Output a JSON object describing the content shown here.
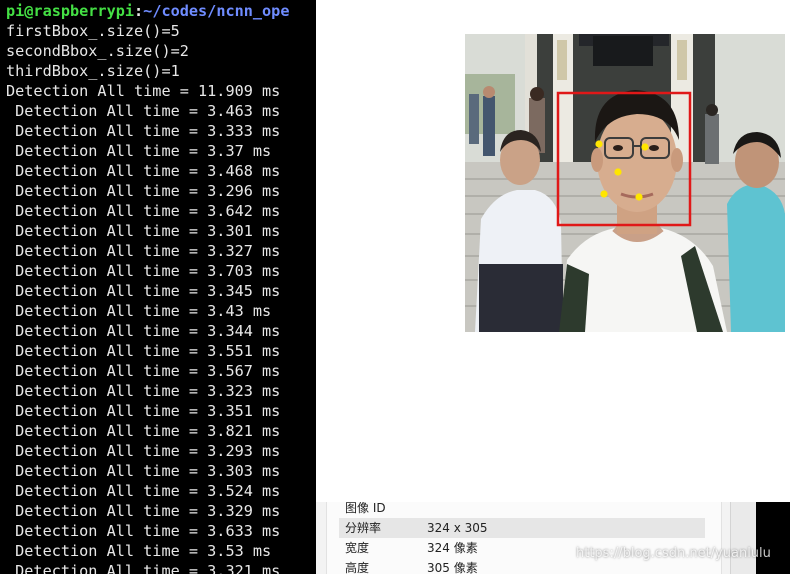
{
  "terminal": {
    "prompt": {
      "user_host": "pi@raspberrypi",
      "separator": ":",
      "path": "~/codes/ncnn_ope"
    },
    "lines": [
      "firstBbox_.size()=5",
      "secondBbox_.size()=2",
      "thirdBbox_.size()=1",
      "Detection All time = 11.909 ms",
      " Detection All time = 3.463 ms",
      " Detection All time = 3.333 ms",
      " Detection All time = 3.37 ms",
      " Detection All time = 3.468 ms",
      " Detection All time = 3.296 ms",
      " Detection All time = 3.642 ms",
      " Detection All time = 3.301 ms",
      " Detection All time = 3.327 ms",
      " Detection All time = 3.703 ms",
      " Detection All time = 3.345 ms",
      " Detection All time = 3.43 ms",
      " Detection All time = 3.344 ms",
      " Detection All time = 3.551 ms",
      " Detection All time = 3.567 ms",
      " Detection All time = 3.323 ms",
      " Detection All time = 3.351 ms",
      " Detection All time = 3.821 ms",
      " Detection All time = 3.293 ms",
      " Detection All time = 3.303 ms",
      " Detection All time = 3.524 ms",
      " Detection All time = 3.329 ms",
      " Detection All time = 3.633 ms",
      " Detection All time = 3.53 ms",
      " Detection All time = 3.321 ms"
    ]
  },
  "properties": {
    "rows": [
      {
        "key": "图像 ID",
        "value": ""
      },
      {
        "key": "分辨率",
        "value": "324 x 305"
      },
      {
        "key": "宽度",
        "value": "324 像素"
      },
      {
        "key": "高度",
        "value": "305 像素"
      }
    ]
  },
  "photo": {
    "box_color": "#e01818",
    "landmark_color": "#ffe600",
    "landmark_count": 5
  },
  "watermark": "https://blog.csdn.net/yuanlulu",
  "colors": {
    "prompt_user": "#44e044",
    "prompt_path": "#6f8cff",
    "terminal_bg": "#000000"
  }
}
